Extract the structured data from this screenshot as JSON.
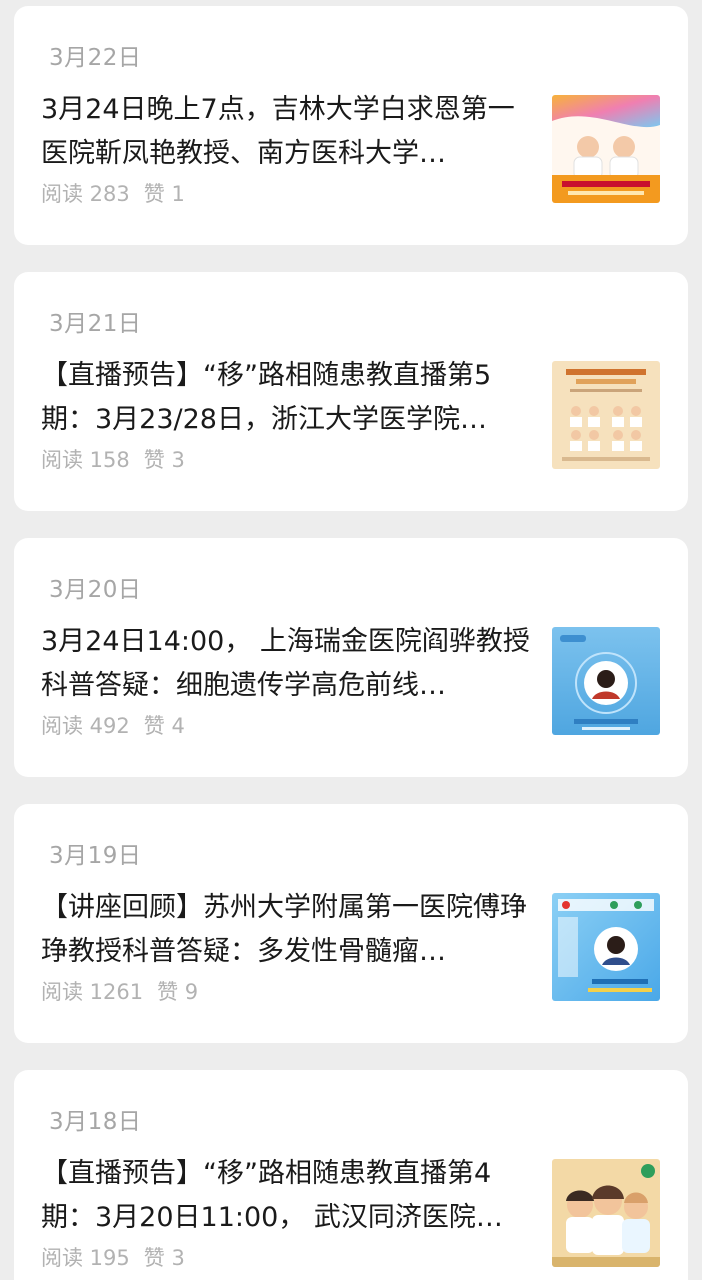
{
  "articles": [
    {
      "date": "3月22日",
      "title": "3月24日晚上7点，吉林大学白求恩第一医院靳凤艳教授、南方医科大学…",
      "reads": "阅读 283",
      "likes": "赞 1",
      "thumb_icon": "article-cover-image"
    },
    {
      "date": "3月21日",
      "title": "【直播预告】“移”路相随患教直播第5期：3月23/28日，浙江大学医学院…",
      "reads": "阅读 158",
      "likes": "赞 3",
      "thumb_icon": "article-cover-image"
    },
    {
      "date": "3月20日",
      "title": "3月24日14:00， 上海瑞金医院阎骅教授科普答疑：细胞遗传学高危前线…",
      "reads": "阅读 492",
      "likes": "赞 4",
      "thumb_icon": "article-cover-image"
    },
    {
      "date": "3月19日",
      "title": "【讲座回顾】苏州大学附属第一医院傅琤琤教授科普答疑：多发性骨髓瘤…",
      "reads": "阅读 1261",
      "likes": "赞 9",
      "thumb_icon": "article-cover-image"
    },
    {
      "date": "3月18日",
      "title": "【直播预告】“移”路相随患教直播第4期：3月20日11:00， 武汉同济医院…",
      "reads": "阅读 195",
      "likes": "赞 3",
      "thumb_icon": "article-cover-image"
    }
  ]
}
